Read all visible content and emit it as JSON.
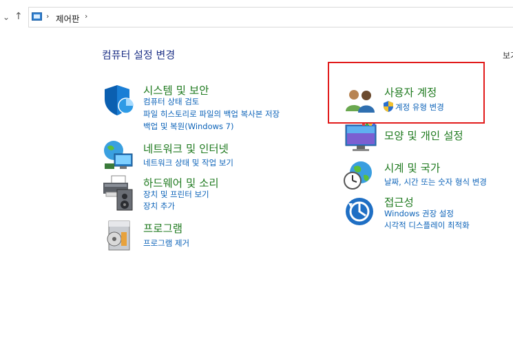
{
  "breadcrumb": {
    "current": "제어판"
  },
  "heading": "컴퓨터 설정 변경",
  "view_by_label": "보기",
  "categories": {
    "system": {
      "title": "시스템 및 보안",
      "links": [
        "컴퓨터 상태 검토",
        "파일 히스토리로 파일의 백업 복사본 저장",
        "백업 및 복원(Windows 7)"
      ]
    },
    "network": {
      "title": "네트워크 및 인터넷",
      "links": [
        "네트워크 상태 및 작업 보기"
      ]
    },
    "hardware": {
      "title": "하드웨어 및 소리",
      "links": [
        "장치 및 프린터 보기",
        "장치 추가"
      ]
    },
    "programs": {
      "title": "프로그램",
      "links": [
        "프로그램 제거"
      ]
    },
    "users": {
      "title": "사용자 계정",
      "links": [
        "계정 유형 변경"
      ]
    },
    "appearance": {
      "title": "모양 및 개인 설정",
      "links": []
    },
    "clock": {
      "title": "시계 및 국가",
      "links": [
        "날짜, 시간 또는 숫자 형식 변경"
      ]
    },
    "ease": {
      "title": "접근성",
      "links": [
        "Windows 권장 설정",
        "시각적 디스플레이 최적화"
      ]
    }
  },
  "accent_colors": {
    "title_green": "#1f7a1f",
    "link_blue": "#0b62b8",
    "highlight_red": "#e11a1a"
  }
}
